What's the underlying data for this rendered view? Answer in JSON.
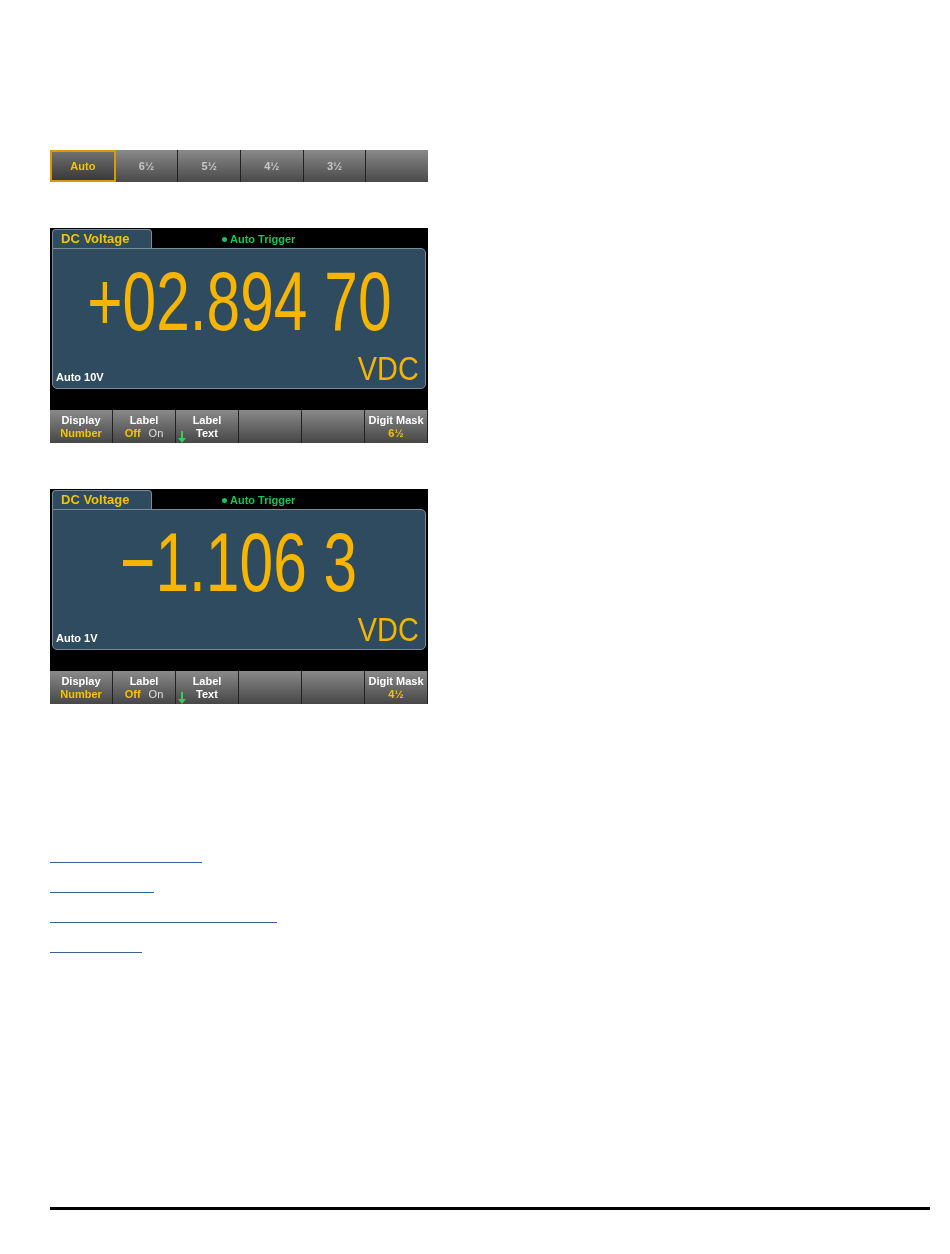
{
  "digit_bar": [
    {
      "label": "Auto",
      "selected": true
    },
    {
      "label": "6½",
      "selected": false
    },
    {
      "label": "5½",
      "selected": false
    },
    {
      "label": "4½",
      "selected": false
    },
    {
      "label": "3½",
      "selected": false
    }
  ],
  "screens": [
    {
      "tab": "DC Voltage",
      "trigger": "Auto Trigger",
      "reading": "+02.894 70",
      "unit": "VDC",
      "range": "Auto 10V",
      "softkeys": [
        {
          "kind": "two_line",
          "top": "Display",
          "bottom": "Number"
        },
        {
          "kind": "toggle",
          "top": "Label",
          "options": [
            {
              "label": "Off",
              "selected": true
            },
            {
              "label": "On",
              "selected": false
            }
          ]
        },
        {
          "kind": "submenu",
          "top": "Label",
          "bottom": "Text"
        },
        {
          "kind": "blank"
        },
        {
          "kind": "blank"
        },
        {
          "kind": "two_line",
          "top": "Digit Mask",
          "bottom": "6½"
        }
      ]
    },
    {
      "tab": "DC Voltage",
      "trigger": "Auto Trigger",
      "reading": "−1.106 3",
      "unit": "VDC",
      "range": "Auto 1V",
      "softkeys": [
        {
          "kind": "two_line",
          "top": "Display",
          "bottom": "Number"
        },
        {
          "kind": "toggle",
          "top": "Label",
          "options": [
            {
              "label": "Off",
              "selected": true
            },
            {
              "label": "On",
              "selected": false
            }
          ]
        },
        {
          "kind": "submenu",
          "top": "Label",
          "bottom": "Text"
        },
        {
          "kind": "blank"
        },
        {
          "kind": "blank"
        },
        {
          "kind": "two_line",
          "top": "Digit Mask",
          "bottom": "4½"
        }
      ]
    }
  ]
}
